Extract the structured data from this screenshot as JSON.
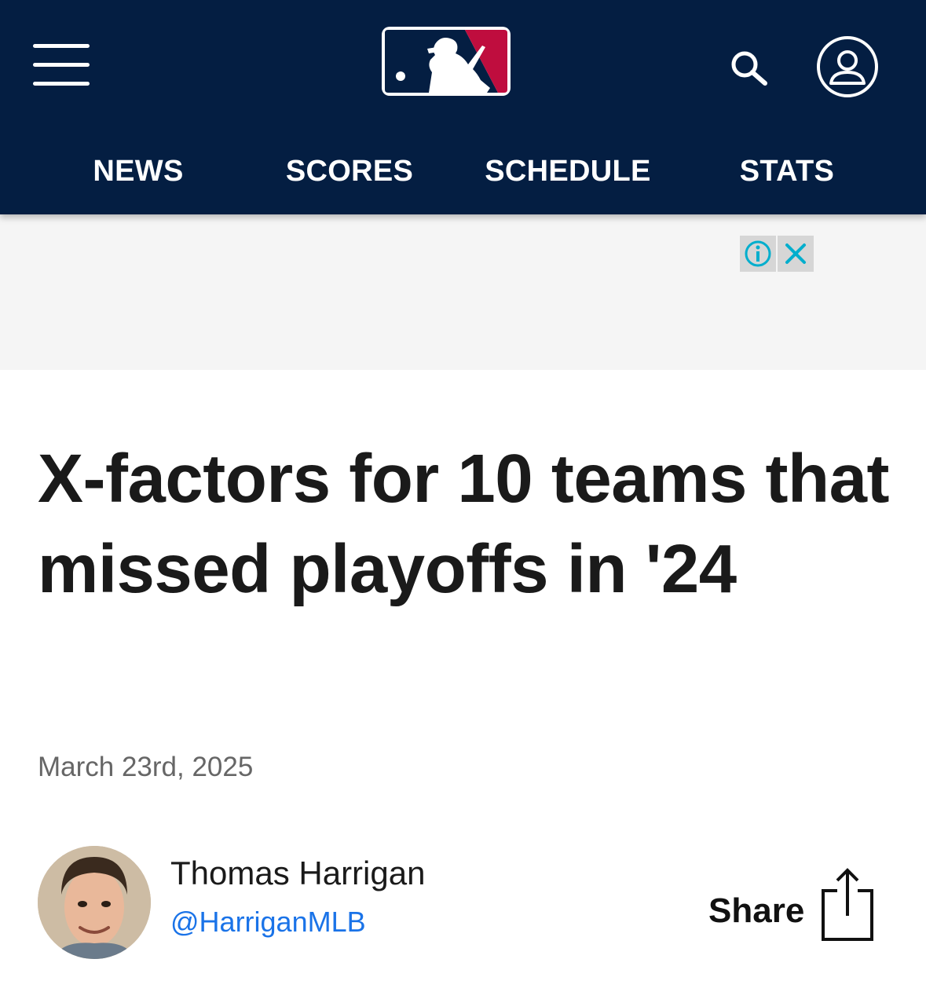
{
  "header": {
    "menu_icon": "hamburger-menu-icon",
    "logo_icon": "mlb-logo",
    "search_icon": "search-icon",
    "account_icon": "account-icon",
    "bg_color": "#041e42",
    "logo_colors": {
      "blue": "#041e42",
      "red": "#bf0d3e"
    }
  },
  "nav": {
    "items": [
      {
        "label": "NEWS"
      },
      {
        "label": "SCORES"
      },
      {
        "label": "SCHEDULE"
      },
      {
        "label": "STATS"
      }
    ]
  },
  "ad": {
    "info_icon": "info-icon",
    "close_icon": "close-icon",
    "accent_color": "#00aecd"
  },
  "article": {
    "headline": "X-factors for 10 teams that missed playoffs in '24",
    "date": "March 23rd, 2025",
    "author": {
      "name": "Thomas Harrigan",
      "handle": "@HarriganMLB",
      "handle_color": "#1a73e8"
    },
    "share": {
      "label": "Share",
      "icon": "share-icon"
    }
  }
}
